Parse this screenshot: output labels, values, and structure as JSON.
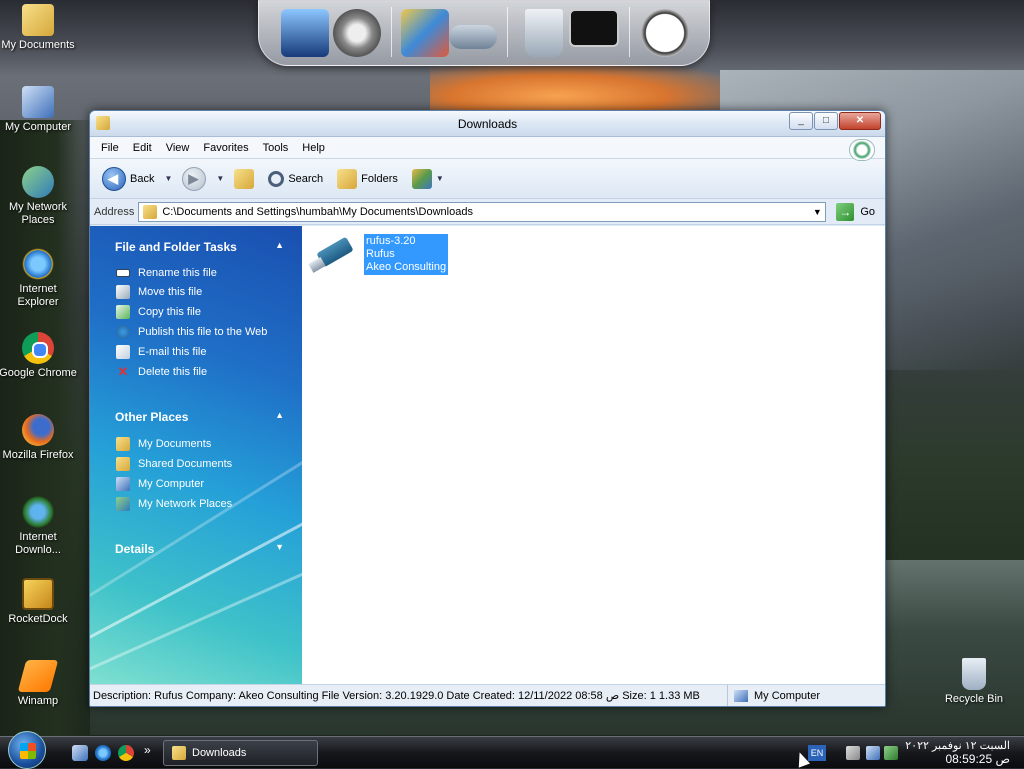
{
  "desktop": {
    "icons": [
      {
        "label": "My Documents"
      },
      {
        "label": "My Computer"
      },
      {
        "label": "My Network Places"
      },
      {
        "label": "Internet Explorer"
      },
      {
        "label": "Google Chrome"
      },
      {
        "label": "Mozilla Firefox"
      },
      {
        "label": "Internet Downlo..."
      },
      {
        "label": "RocketDock"
      },
      {
        "label": "Winamp"
      },
      {
        "label": "Recycle Bin"
      }
    ]
  },
  "window": {
    "title": "Downloads",
    "buttons": {
      "minimize": "_",
      "maximize": "□",
      "close": "✕"
    },
    "menu": [
      "File",
      "Edit",
      "View",
      "Favorites",
      "Tools",
      "Help"
    ],
    "toolbar": {
      "back": "Back",
      "search": "Search",
      "folders": "Folders"
    },
    "address": {
      "label": "Address",
      "path": "C:\\Documents and Settings\\humbah\\My Documents\\Downloads",
      "go": "Go"
    },
    "tasks": {
      "file_folder_tasks": {
        "title": "File and Folder Tasks",
        "items": [
          "Rename this file",
          "Move this file",
          "Copy this file",
          "Publish this file to the Web",
          "E-mail this file",
          "Delete this file"
        ]
      },
      "other_places": {
        "title": "Other Places",
        "items": [
          "My Documents",
          "Shared Documents",
          "My Computer",
          "My Network Places"
        ]
      },
      "details": {
        "title": "Details"
      }
    },
    "files": [
      {
        "name": "rufus-3.20",
        "product": "Rufus",
        "company": "Akeo Consulting"
      }
    ],
    "status": {
      "description": "Description: Rufus Company: Akeo Consulting File Version: 3.20.1929.0 Date Created: 12/11/2022 08:58 ص Size: 1 1.33 MB",
      "location": "My Computer"
    }
  },
  "taskbar": {
    "task_label": "Downloads",
    "quicklaunch_more": "»",
    "language": "EN",
    "clock_date": "السبت ١٢ نوفمبر ٢٠٢٢",
    "clock_time": "08:59:25 ص"
  }
}
